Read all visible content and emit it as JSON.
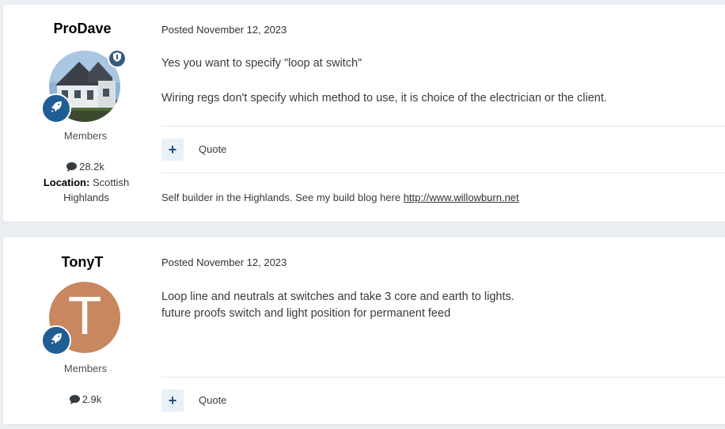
{
  "posts": [
    {
      "author": "ProDave",
      "avatar_type": "photo",
      "group": "Members",
      "post_count": "28.2k",
      "location_label": "Location:",
      "location_value": "Scottish Highlands",
      "posted": "Posted November 12, 2023",
      "content": [
        "Yes you want to specify \"loop at switch\"",
        "Wiring regs don't specify which method to use, it is choice of the electrician or the client."
      ],
      "quote_label": "Quote",
      "signature_text": "Self builder in the Highlands. See my build blog here ",
      "signature_link": "http://www.willowburn.net"
    },
    {
      "author": "TonyT",
      "avatar_type": "letter",
      "avatar_letter": "T",
      "group": "Members",
      "post_count": "2.9k",
      "posted": "Posted November 12, 2023",
      "content": [
        "Loop line and neutrals at switches and take 3 core and earth to lights.",
        "future proofs switch and light position for permanent feed"
      ],
      "quote_label": "Quote"
    }
  ],
  "icons": {
    "plus": "+",
    "rank_badge": "rocket-icon",
    "moderator_badge": "shield-icon",
    "post_count": "comment-icon"
  },
  "colors": {
    "badge": "#1f5e94",
    "avatar_letter_bg": "#c8875e",
    "page_bg": "#ebeef2"
  }
}
